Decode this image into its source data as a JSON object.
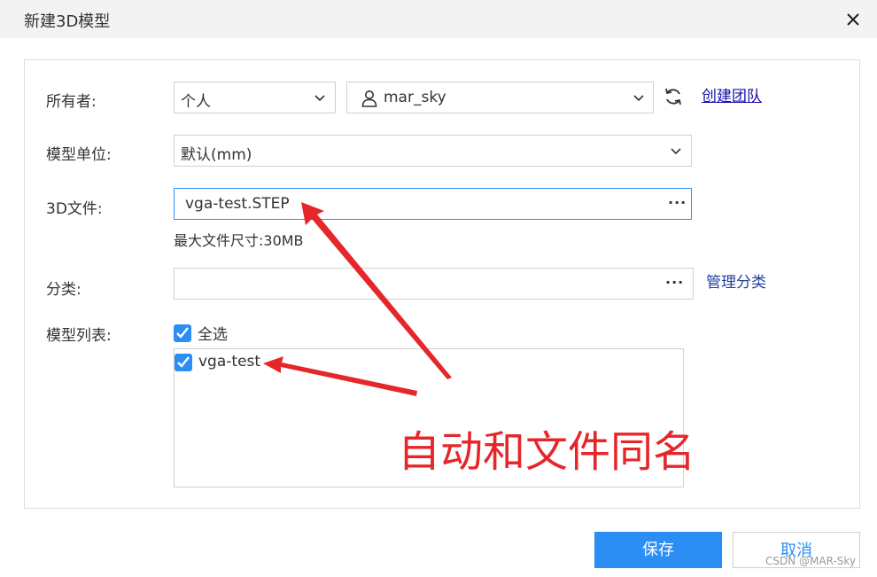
{
  "dialog": {
    "title": "新建3D模型"
  },
  "form": {
    "owner_label": "所有者:",
    "owner_type_value": "个人",
    "owner_user_value": "mar_sky",
    "create_team_link": "创建团队",
    "unit_label": "模型单位:",
    "unit_value": "默认(mm)",
    "file_label": "3D文件:",
    "file_value": "vga-test.STEP",
    "file_browse": "···",
    "max_size_hint": "最大文件尺寸:30MB",
    "category_label": "分类:",
    "category_value": "",
    "category_browse": "···",
    "manage_category_link": "管理分类",
    "model_list_label": "模型列表:",
    "select_all_label": "全选",
    "select_all_checked": true,
    "models": [
      {
        "name": "vga-test",
        "checked": true
      }
    ]
  },
  "buttons": {
    "save": "保存",
    "cancel": "取消"
  },
  "annotation": {
    "text": "自动和文件同名",
    "color": "#e5262a"
  },
  "watermark": "CSDN @MAR-Sky",
  "colors": {
    "primary": "#2b8ef5",
    "link": "#1a0dab"
  },
  "icons": {
    "close": "close-icon",
    "refresh": "refresh-icon",
    "user": "user-icon",
    "chevron": "chevron-down-icon",
    "check": "check-icon"
  }
}
